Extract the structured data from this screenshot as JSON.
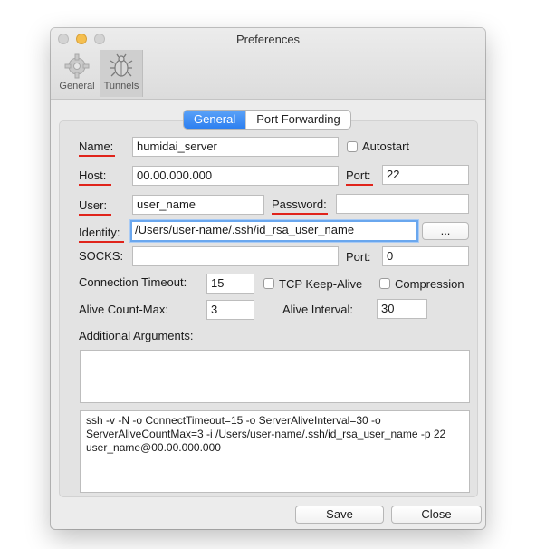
{
  "window": {
    "title": "Preferences"
  },
  "toolbar": {
    "items": [
      {
        "label": "General",
        "icon": "gear-icon",
        "active": false
      },
      {
        "label": "Tunnels",
        "icon": "bug-icon",
        "active": true
      }
    ]
  },
  "tabs": [
    {
      "label": "General",
      "selected": true
    },
    {
      "label": "Port Forwarding",
      "selected": false
    }
  ],
  "form": {
    "name": {
      "label": "Name:",
      "value": "humidai_server"
    },
    "autostart": {
      "label": "Autostart",
      "checked": false
    },
    "host": {
      "label": "Host:",
      "value": "00.00.000.000"
    },
    "port": {
      "label": "Port:",
      "value": "22"
    },
    "user": {
      "label": "User:",
      "value": "user_name"
    },
    "password": {
      "label": "Password:",
      "value": ""
    },
    "identity": {
      "label": "Identity:",
      "value": "/Users/user-name/.ssh/id_rsa_user_name",
      "browse_label": "..."
    },
    "socks": {
      "label": "SOCKS:",
      "value": ""
    },
    "socks_port": {
      "label": "Port:",
      "value": "0"
    },
    "connection_timeout": {
      "label": "Connection Timeout:",
      "value": "15"
    },
    "tcp_keepalive": {
      "label": "TCP Keep-Alive",
      "checked": false
    },
    "compression": {
      "label": "Compression",
      "checked": false
    },
    "alive_count_max": {
      "label": "Alive Count-Max:",
      "value": "3"
    },
    "alive_interval": {
      "label": "Alive Interval:",
      "value": "30"
    },
    "additional_arguments": {
      "label": "Additional Arguments:",
      "value": ""
    },
    "command_preview": "ssh -v -N -o ConnectTimeout=15 -o ServerAliveInterval=30 -o ServerAliveCountMax=3 -i /Users/user-name/.ssh/id_rsa_user_name -p 22 user_name@00.00.000.000"
  },
  "buttons": {
    "save": "Save",
    "close": "Close"
  },
  "colors": {
    "accent": "#2d7ff0",
    "highlight_underline": "#e0241b",
    "focus_ring": "#6aa7ee"
  }
}
